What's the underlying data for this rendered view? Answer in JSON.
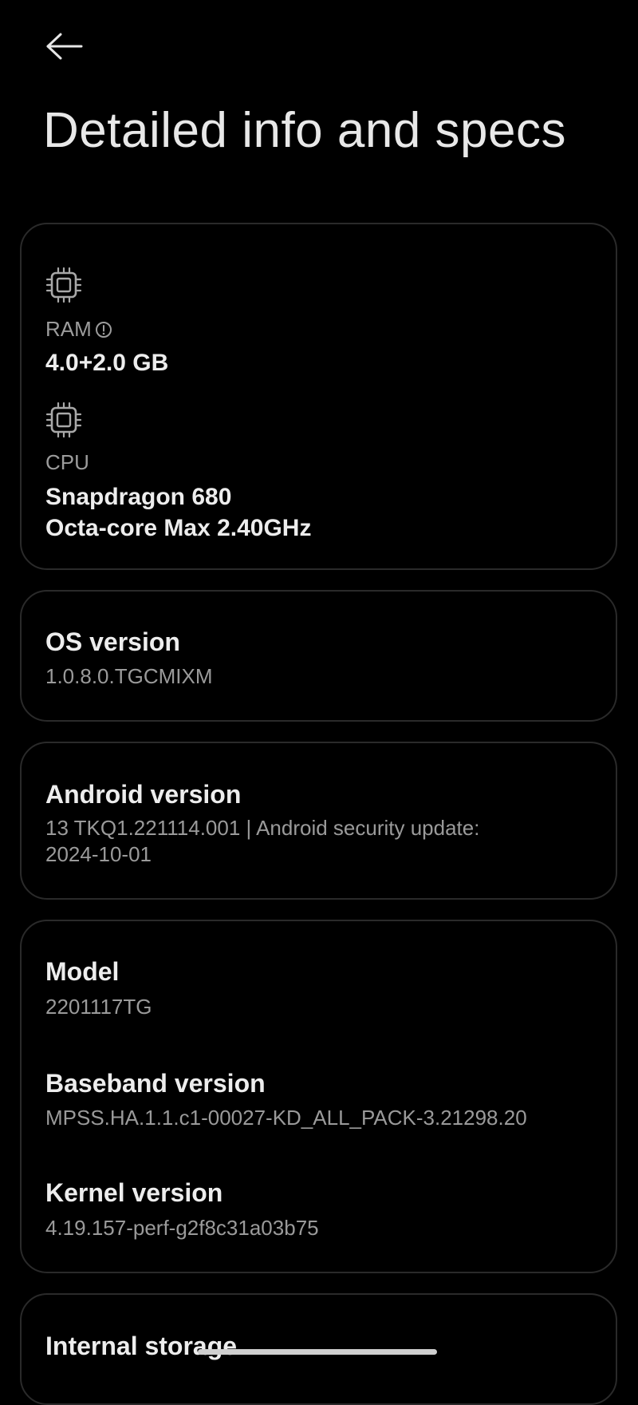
{
  "header": {
    "back_icon": "arrow-left-icon",
    "title": "Detailed info and specs"
  },
  "hardware": {
    "ram": {
      "icon": "chip-icon",
      "label": "RAM",
      "info_icon": "info-circle-icon",
      "value": "4.0+2.0 GB"
    },
    "cpu": {
      "icon": "chip-icon",
      "label": "CPU",
      "value_line1": "Snapdragon 680",
      "value_line2": "Octa-core Max 2.40GHz"
    }
  },
  "os": {
    "title": "OS version",
    "value": "1.0.8.0.TGCMIXM"
  },
  "android": {
    "title": "Android version",
    "value_line1": "13 TKQ1.221114.001 | Android security update:",
    "value_line2": "2024-10-01"
  },
  "device": {
    "model": {
      "title": "Model",
      "value": "2201117TG"
    },
    "baseband": {
      "title": "Baseband version",
      "value": "MPSS.HA.1.1.c1-00027-KD_ALL_PACK-3.21298.20"
    },
    "kernel": {
      "title": "Kernel version",
      "value": "4.19.157-perf-g2f8c31a03b75"
    }
  },
  "storage": {
    "title": "Internal storage"
  },
  "colors": {
    "background": "#000000",
    "card_border": "#2a2a2a",
    "primary_text": "#ededed",
    "secondary_text": "#9a9a9a"
  }
}
